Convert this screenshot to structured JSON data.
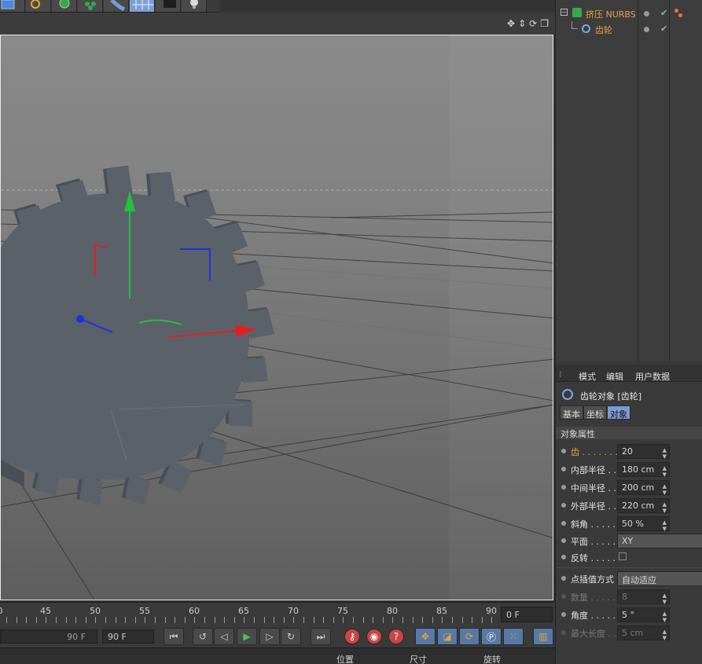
{
  "object_manager": {
    "objects": [
      {
        "name": "挤压 NURBS",
        "icon": "extrude-nurbs-icon"
      },
      {
        "name": "齿轮",
        "icon": "gear-spline-icon"
      }
    ]
  },
  "viewport": {
    "header_icons": [
      "move-view-icon",
      "zoom-view-icon",
      "rotate-view-icon",
      "maximize-view-icon"
    ]
  },
  "timeline": {
    "ticks": [
      "0",
      "45",
      "50",
      "55",
      "60",
      "65",
      "70",
      "75",
      "80",
      "85",
      "90"
    ],
    "current_frame": "0 F"
  },
  "transport": {
    "start_field": "90 F",
    "end_field": "90 F"
  },
  "bottom_bar": {
    "labels": [
      "位置",
      "尺寸",
      "旋转"
    ]
  },
  "attribute_manager": {
    "menu": [
      "模式",
      "编辑",
      "用户数据"
    ],
    "object_title": "齿轮对象 [齿轮]",
    "tabs": [
      "基本",
      "坐标",
      "对象"
    ],
    "active_tab": "对象",
    "section": "对象属性",
    "properties": [
      {
        "label": "齿 . . . . . . .",
        "value": "20",
        "highlight": true
      },
      {
        "label": "内部半径 . .",
        "value": "180 cm"
      },
      {
        "label": "中间半径 . .",
        "value": "200 cm"
      },
      {
        "label": "外部半径 . .",
        "value": "220 cm"
      },
      {
        "label": "斜角 . . . . .",
        "value": "50 %"
      },
      {
        "label": "平面 . . . . .",
        "value": "XY"
      },
      {
        "label": "反转 . . . . .",
        "value": ""
      },
      {
        "label": "点插值方式",
        "value": "自动适应"
      },
      {
        "label": "数量 . . . . .",
        "value": "8"
      },
      {
        "label": "角度 . . . . .",
        "value": "5 °"
      },
      {
        "label": "最大长度 . .",
        "value": "5 cm"
      }
    ]
  },
  "colors": {
    "accent_orange": "#e8a24a",
    "active_tab_blue": "#7a9bd2",
    "axis_x": "#e02020",
    "axis_y": "#22c040",
    "axis_z": "#2030e0",
    "gear": "#5a6068"
  }
}
